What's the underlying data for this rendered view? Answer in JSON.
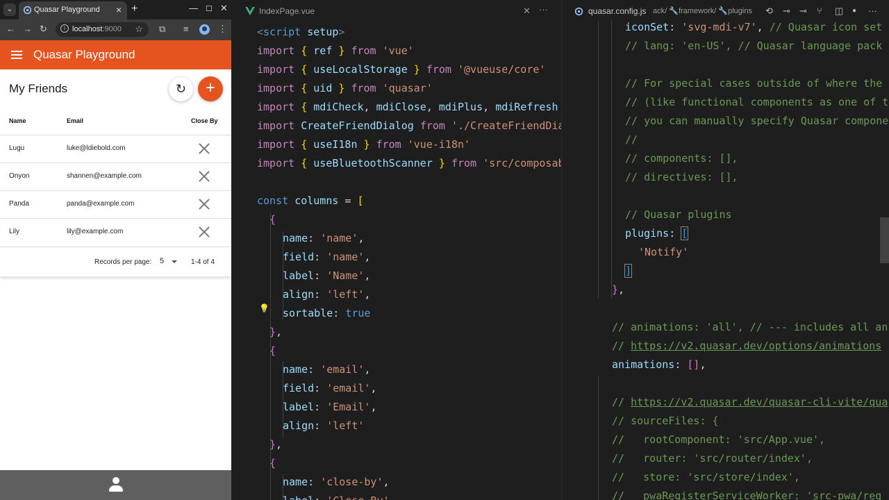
{
  "browser": {
    "tab_title": "Quasar Playground",
    "url_host": "localhost",
    "url_port": ":9000"
  },
  "app": {
    "title": "Quasar Playground",
    "card_title": "My Friends"
  },
  "table": {
    "columns": [
      "Name",
      "Email",
      "Close By"
    ],
    "rows": [
      {
        "name": "Lugu",
        "email": "luke@ldiebold.com"
      },
      {
        "name": "Onyon",
        "email": "shannen@example.com"
      },
      {
        "name": "Panda",
        "email": "panda@example.com"
      },
      {
        "name": "Lily",
        "email": "lily@example.com"
      }
    ],
    "rows_per_page_label": "Records per page:",
    "rows_per_page": "5",
    "range": "1-4 of 4"
  },
  "editor_left": {
    "tab": "IndexPage.vue"
  },
  "editor_right": {
    "tab": "quasar.config.js",
    "breadcrumb": "ack/",
    "breadcrumb_framework": "framework/",
    "breadcrumb_plugins": "plugins"
  }
}
